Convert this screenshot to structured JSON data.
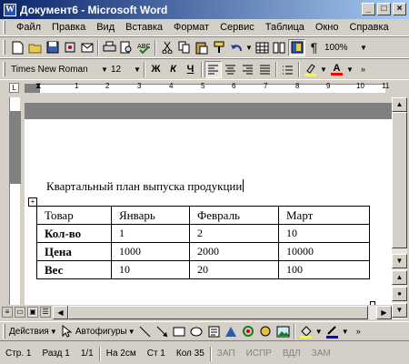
{
  "window": {
    "title": "Документ6 - Microsoft Word",
    "icon": "word-icon"
  },
  "menu": [
    "Файл",
    "Правка",
    "Вид",
    "Вставка",
    "Формат",
    "Сервис",
    "Таблица",
    "Окно",
    "Справка"
  ],
  "toolbar": {
    "zoom": "100%",
    "font_name": "Times New Roman",
    "font_size": "12",
    "bold": "Ж",
    "italic": "К",
    "underline": "Ч",
    "paragraph_mark": "¶",
    "font_color_letter": "A"
  },
  "ruler": {
    "numbers": [
      "1",
      "2",
      "3",
      "4",
      "5",
      "6",
      "7",
      "8",
      "9",
      "10",
      "11"
    ]
  },
  "document": {
    "heading": "Квартальный план выпуска продукции",
    "table": {
      "header": [
        "Товар",
        "Январь",
        "Февраль",
        "Март"
      ],
      "rows": [
        [
          "Кол-во",
          "1",
          "2",
          "10"
        ],
        [
          "Цена",
          "1000",
          "2000",
          "10000"
        ],
        [
          "Вес",
          "10",
          "20",
          "100"
        ]
      ]
    }
  },
  "drawing": {
    "actions_label": "Действия",
    "autoshapes_label": "Автофигуры"
  },
  "status": {
    "page": "Стр. 1",
    "section": "Разд 1",
    "pages": "1/1",
    "position": "На 2см",
    "line": "Ст 1",
    "column": "Кол 35",
    "rec": "ЗАП",
    "trk": "ИСПР",
    "ext": "ВДЛ",
    "ovr": "ЗАМ"
  },
  "colors": {
    "title_start": "#0a246a",
    "title_end": "#a6caf0",
    "chrome": "#d4d0c8",
    "highlight": "#ffff00",
    "font_color": "#ff0000"
  }
}
